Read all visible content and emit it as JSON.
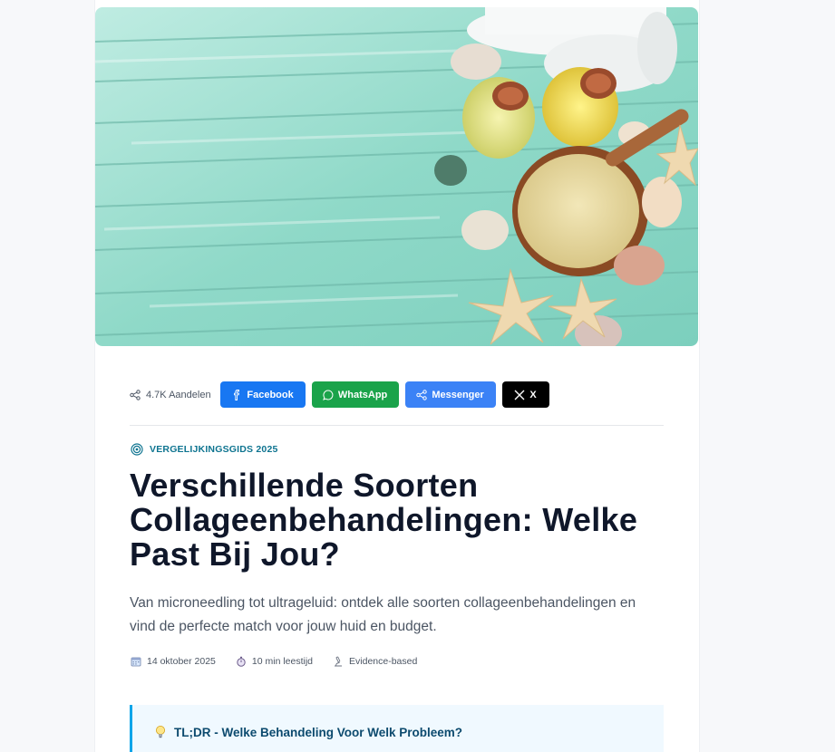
{
  "hero": {
    "image_alt": "Spa still life: rolled white towels, oil bottles, bowl of bath salt with wooden spoon, starfish and seashells on turquoise wooden planks"
  },
  "share": {
    "count_label": "4.7K Aandelen",
    "share_icon": "share-icon",
    "buttons": [
      {
        "label": "Facebook",
        "icon": "facebook-icon",
        "color": "#1877f2"
      },
      {
        "label": "WhatsApp",
        "icon": "whatsapp-icon",
        "color": "#1aa34a"
      },
      {
        "label": "Messenger",
        "icon": "share-icon",
        "color": "#3b82f6"
      },
      {
        "label": "X",
        "icon": "x-icon",
        "color": "#000000"
      }
    ]
  },
  "article": {
    "category": "VERGELIJKINGSGIDS 2025",
    "category_icon": "target-icon",
    "title": "Verschillende Soorten Collageenbehandelingen: Welke Past Bij Jou?",
    "subtitle": "Van microneedling tot ultrageluid: ontdek alle soorten collageenbehandelingen en vind de perfecte match voor jouw huid en budget.",
    "meta": [
      {
        "icon": "calendar-icon",
        "text": "14 oktober 2025"
      },
      {
        "icon": "stopwatch-icon",
        "text": "10 min leestijd"
      },
      {
        "icon": "microscope-icon",
        "text": "Evidence-based"
      }
    ]
  },
  "tldr": {
    "icon": "lightbulb-icon",
    "heading": "TL;DR - Welke Behandeling Voor Welk Probleem?"
  },
  "colors": {
    "accent": "#0e7490",
    "title": "#0f172a",
    "tldr_border": "#0ea5e9",
    "tldr_bg": "#f0f9ff"
  }
}
